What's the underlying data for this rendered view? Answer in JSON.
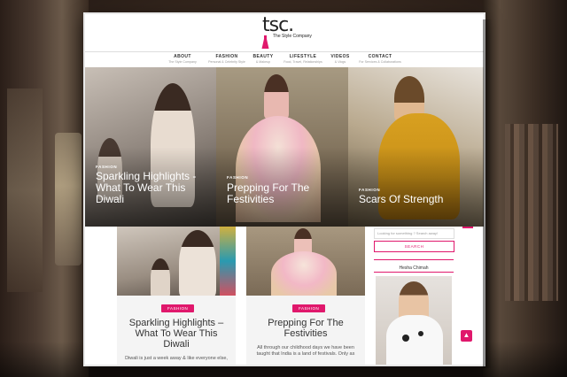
{
  "logo": {
    "text": "tsc.",
    "tagline": "The Style Company"
  },
  "nav": [
    {
      "label": "ABOUT",
      "sub": "The Style Company"
    },
    {
      "label": "FASHION",
      "sub": "Personal & Celebrity Style"
    },
    {
      "label": "BEAUTY",
      "sub": "& Makeup"
    },
    {
      "label": "LIFESTYLE",
      "sub": "Food, Travel, Relationships"
    },
    {
      "label": "VIDEOS",
      "sub": "& Vlogs"
    },
    {
      "label": "CONTACT",
      "sub": "For Services & Collaborations"
    }
  ],
  "hero": [
    {
      "category": "FASHION",
      "title": "Sparkling Highlights - What To Wear This Diwali"
    },
    {
      "category": "FASHION",
      "title": "Prepping For The Festivities"
    },
    {
      "category": "FASHION",
      "title": "Scars Of Strength"
    }
  ],
  "cards": [
    {
      "badge": "FASHION",
      "title": "Sparkling Highlights – What To Wear This Diwali",
      "excerpt": "Diwali is just a week away & like everyone else,"
    },
    {
      "badge": "FASHION",
      "title": "Prepping For The Festivities",
      "excerpt": "All through our childhood days we have been taught that India is a land of festivals. Only as"
    }
  ],
  "sidebar": {
    "search_placeholder": "Looking for something ? Search away!",
    "search_button": "SEARCH",
    "author": "Hesha Chimah"
  },
  "back_to_top": "▲",
  "colors": {
    "accent": "#e0186c"
  }
}
